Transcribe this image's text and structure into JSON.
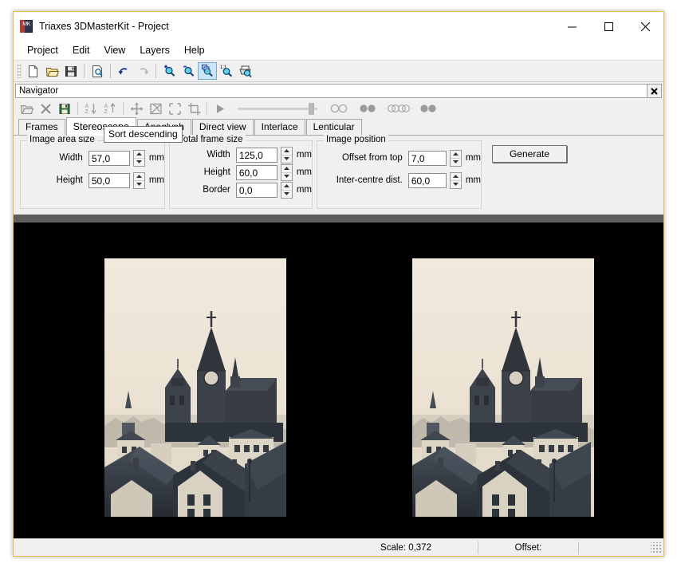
{
  "window": {
    "title": "Triaxes 3DMasterKit - Project",
    "app_icon": "app-icon",
    "minimize": "─",
    "maximize": "□",
    "close": "✕"
  },
  "menubar": {
    "items": [
      {
        "label": "Project"
      },
      {
        "label": "Edit"
      },
      {
        "label": "View"
      },
      {
        "label": "Layers"
      },
      {
        "label": "Help"
      }
    ]
  },
  "toolbar": {
    "buttons": [
      {
        "name": "new-file-icon",
        "title": "New"
      },
      {
        "name": "open-file-icon",
        "title": "Open"
      },
      {
        "name": "save-file-icon",
        "title": "Save"
      },
      {
        "name": "print-preview-icon",
        "title": "Print preview"
      },
      {
        "name": "undo-icon",
        "title": "Undo"
      },
      {
        "name": "redo-icon",
        "title": "Redo"
      },
      {
        "name": "zoom-in-icon",
        "title": "Zoom in"
      },
      {
        "name": "zoom-out-icon",
        "title": "Zoom out"
      },
      {
        "name": "zoom-fit-icon",
        "title": "Fit to window"
      },
      {
        "name": "zoom-actual-icon",
        "title": "1:1"
      },
      {
        "name": "print-icon",
        "title": "Print"
      }
    ]
  },
  "navigator": {
    "title": "Navigator",
    "close_label": "✖",
    "buttons": [
      {
        "name": "open-frames-icon"
      },
      {
        "name": "delete-frame-icon"
      },
      {
        "name": "save-frames-icon"
      },
      {
        "name": "sort-descending-icon"
      },
      {
        "name": "sort-ascending-icon"
      },
      {
        "name": "move-icon"
      },
      {
        "name": "transform-icon"
      },
      {
        "name": "fit-frame-icon"
      },
      {
        "name": "crop-icon"
      },
      {
        "name": "play-icon"
      }
    ],
    "stereo_modes": [
      "mode-outline-pair",
      "mode-filled-pair",
      "mode-multi-pair",
      "mode-filled-pair-2"
    ]
  },
  "tooltip": {
    "text": "Sort descending"
  },
  "tabs": [
    {
      "label": "Frames",
      "active": false
    },
    {
      "label": "Stereoscope",
      "active": true
    },
    {
      "label": "Anaglyph",
      "active": false
    },
    {
      "label": "Direct view",
      "active": false
    },
    {
      "label": "Interlace",
      "active": false
    },
    {
      "label": "Lenticular",
      "active": false
    }
  ],
  "panel": {
    "groups": [
      {
        "title": "Image area size",
        "fields": [
          {
            "label": "Width",
            "value": "57,0",
            "unit": "mm"
          },
          {
            "label": "Height",
            "value": "50,0",
            "unit": "mm"
          }
        ]
      },
      {
        "title": "Total frame size",
        "fields": [
          {
            "label": "Width",
            "value": "125,0",
            "unit": "mm"
          },
          {
            "label": "Height",
            "value": "60,0",
            "unit": "mm"
          },
          {
            "label": "Border",
            "value": "0,0",
            "unit": "mm"
          }
        ]
      },
      {
        "title": "Image position",
        "fields": [
          {
            "label": "Offset from top",
            "value": "7,0",
            "unit": "mm"
          },
          {
            "label": "Inter-centre dist.",
            "value": "60,0",
            "unit": "mm"
          }
        ]
      }
    ],
    "generate_label": "Generate"
  },
  "canvas": {
    "background": "#000000",
    "photo_alt": "stereo pair photograph of a cathedral above old town rooftops"
  },
  "statusbar": {
    "scale_label": "Scale:  0,372",
    "offset_label": "Offset:",
    "extra": ""
  }
}
